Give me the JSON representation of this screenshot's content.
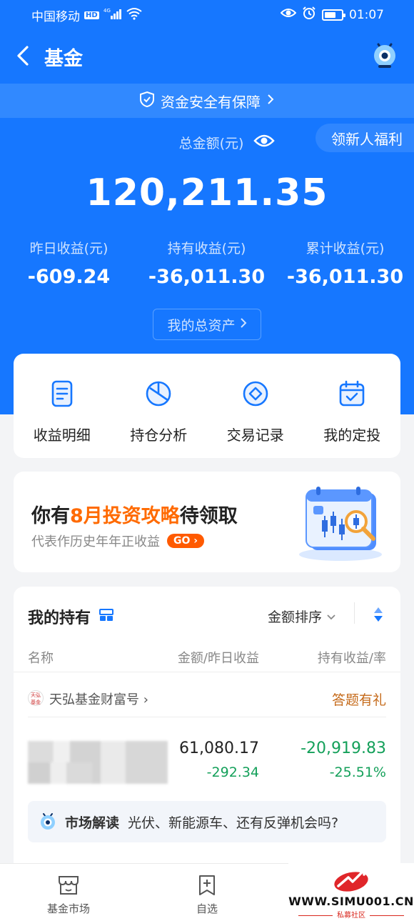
{
  "status_bar": {
    "carrier": "中国移动",
    "hd": "HD",
    "network": "4G",
    "time": "01:07",
    "battery_level": 0.7
  },
  "nav": {
    "title": "基金"
  },
  "safety_banner": {
    "text": "资金安全有保障"
  },
  "newbie_tag": {
    "text": "领新人福利"
  },
  "summary": {
    "total_label": "总金额(元)",
    "total_amount": "120,211.35",
    "stats": [
      {
        "label": "昨日收益(元)",
        "value": "-609.24"
      },
      {
        "label": "持有收益(元)",
        "value": "-36,011.30"
      },
      {
        "label": "累计收益(元)",
        "value": "-36,011.30"
      }
    ],
    "assets_button": "我的总资产"
  },
  "quick_actions": [
    {
      "label": "收益明细",
      "icon": "document-icon"
    },
    {
      "label": "持仓分析",
      "icon": "pie-chart-icon"
    },
    {
      "label": "交易记录",
      "icon": "diamond-coin-icon"
    },
    {
      "label": "我的定投",
      "icon": "calendar-check-icon"
    }
  ],
  "promo": {
    "title_pre": "你有",
    "title_highlight": "8月投资攻略",
    "title_post": "待领取",
    "subtitle": "代表作历史年年正收益",
    "go_label": "GO"
  },
  "holdings": {
    "title": "我的持有",
    "sort_label": "金额排序",
    "columns": {
      "name": "名称",
      "amount": "金额/昨日收益",
      "profit": "持有收益/率"
    },
    "company": {
      "name": "天弘基金财富号",
      "logo_text": "天弘基金",
      "prize": "答题有礼"
    },
    "fund": {
      "amount": "61,080.17",
      "yesterday": "-292.34",
      "hold_profit": "-20,919.83",
      "hold_rate": "-25.51%"
    },
    "market": {
      "lead": "市场解读",
      "text": "光伏、新能源车、还有反弹机会吗?"
    }
  },
  "tabbar": [
    {
      "label": "基金市场",
      "icon": "market-icon"
    },
    {
      "label": "自选",
      "icon": "bookmark-add-icon"
    }
  ],
  "watermark": {
    "url": "WWW.SIMU001.CN",
    "sub": "私募社区"
  },
  "colors": {
    "primary": "#1677ff",
    "down_green": "#14a05a",
    "accent_orange": "#ff6a00"
  }
}
